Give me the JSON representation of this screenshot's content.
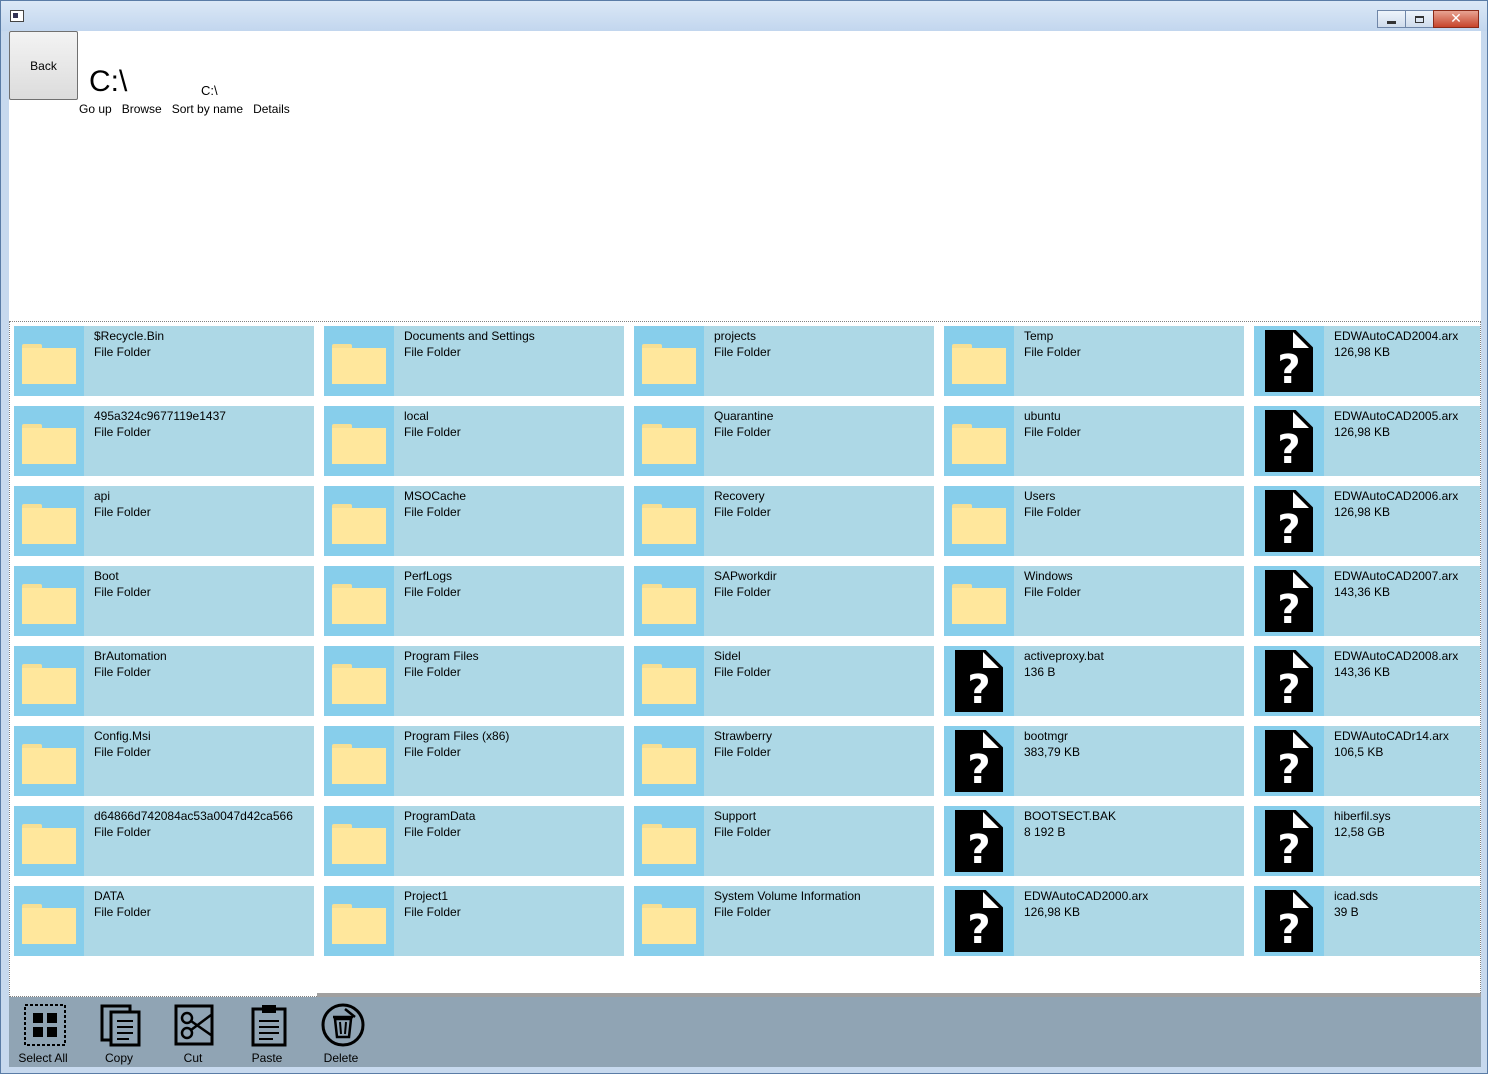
{
  "window": {
    "caption_min": "–",
    "caption_max": "□",
    "caption_close": "✕"
  },
  "header": {
    "back_label": "Back",
    "path_large": "C:\\",
    "path_small": "C:\\",
    "links": [
      "Go up",
      "Browse",
      "Sort by name",
      "Details"
    ]
  },
  "colors": {
    "tile_bg": "#add8e6",
    "icon_bg": "#87ceeb",
    "folder": "#ffe79c",
    "bottom_bar": "#90a4b4"
  },
  "items": [
    {
      "name": "$Recycle.Bin",
      "info": "File Folder",
      "type": "folder"
    },
    {
      "name": "Documents and Settings",
      "info": "File Folder",
      "type": "folder"
    },
    {
      "name": "projects",
      "info": "File Folder",
      "type": "folder"
    },
    {
      "name": "Temp",
      "info": "File Folder",
      "type": "folder"
    },
    {
      "name": "EDWAutoCAD2004.arx",
      "info": "126,98 KB",
      "type": "file"
    },
    {
      "name": "495a324c9677119e1437",
      "info": "File Folder",
      "type": "folder"
    },
    {
      "name": "local",
      "info": "File Folder",
      "type": "folder"
    },
    {
      "name": "Quarantine",
      "info": "File Folder",
      "type": "folder"
    },
    {
      "name": "ubuntu",
      "info": "File Folder",
      "type": "folder"
    },
    {
      "name": "EDWAutoCAD2005.arx",
      "info": "126,98 KB",
      "type": "file"
    },
    {
      "name": "api",
      "info": "File Folder",
      "type": "folder"
    },
    {
      "name": "MSOCache",
      "info": "File Folder",
      "type": "folder"
    },
    {
      "name": "Recovery",
      "info": "File Folder",
      "type": "folder"
    },
    {
      "name": "Users",
      "info": "File Folder",
      "type": "folder"
    },
    {
      "name": "EDWAutoCAD2006.arx",
      "info": "126,98 KB",
      "type": "file"
    },
    {
      "name": "Boot",
      "info": "File Folder",
      "type": "folder"
    },
    {
      "name": "PerfLogs",
      "info": "File Folder",
      "type": "folder"
    },
    {
      "name": "SAPworkdir",
      "info": "File Folder",
      "type": "folder"
    },
    {
      "name": "Windows",
      "info": "File Folder",
      "type": "folder"
    },
    {
      "name": "EDWAutoCAD2007.arx",
      "info": "143,36 KB",
      "type": "file"
    },
    {
      "name": "BrAutomation",
      "info": "File Folder",
      "type": "folder"
    },
    {
      "name": "Program Files",
      "info": "File Folder",
      "type": "folder"
    },
    {
      "name": "Sidel",
      "info": "File Folder",
      "type": "folder"
    },
    {
      "name": "activeproxy.bat",
      "info": "136 B",
      "type": "file"
    },
    {
      "name": "EDWAutoCAD2008.arx",
      "info": "143,36 KB",
      "type": "file"
    },
    {
      "name": "Config.Msi",
      "info": "File Folder",
      "type": "folder"
    },
    {
      "name": "Program Files (x86)",
      "info": "File Folder",
      "type": "folder"
    },
    {
      "name": "Strawberry",
      "info": "File Folder",
      "type": "folder"
    },
    {
      "name": "bootmgr",
      "info": "383,79 KB",
      "type": "file"
    },
    {
      "name": "EDWAutoCADr14.arx",
      "info": "106,5 KB",
      "type": "file"
    },
    {
      "name": "d64866d742084ac53a0047d42ca566",
      "info": "File Folder",
      "type": "folder"
    },
    {
      "name": "ProgramData",
      "info": "File Folder",
      "type": "folder"
    },
    {
      "name": "Support",
      "info": "File Folder",
      "type": "folder"
    },
    {
      "name": "BOOTSECT.BAK",
      "info": "8 192 B",
      "type": "file"
    },
    {
      "name": "hiberfil.sys",
      "info": "12,58 GB",
      "type": "file"
    },
    {
      "name": "DATA",
      "info": "File Folder",
      "type": "folder"
    },
    {
      "name": "Project1",
      "info": "File Folder",
      "type": "folder"
    },
    {
      "name": "System Volume Information",
      "info": "File Folder",
      "type": "folder"
    },
    {
      "name": "EDWAutoCAD2000.arx",
      "info": "126,98 KB",
      "type": "file"
    },
    {
      "name": "icad.sds",
      "info": "39 B",
      "type": "file"
    }
  ],
  "actions": [
    {
      "id": "select-all",
      "label": "Select All",
      "icon": "select-all-icon"
    },
    {
      "id": "copy",
      "label": "Copy",
      "icon": "copy-icon"
    },
    {
      "id": "cut",
      "label": "Cut",
      "icon": "cut-icon"
    },
    {
      "id": "paste",
      "label": "Paste",
      "icon": "paste-icon"
    },
    {
      "id": "delete",
      "label": "Delete",
      "icon": "delete-icon"
    }
  ]
}
